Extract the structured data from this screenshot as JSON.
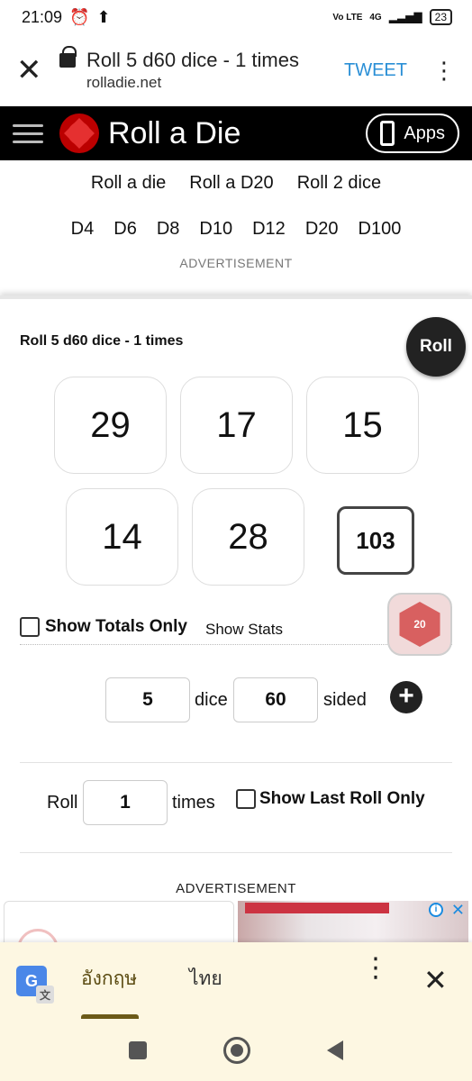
{
  "status": {
    "time": "21:09",
    "network": "4G",
    "volte": "Vo LTE",
    "battery": "23"
  },
  "browser": {
    "page_title": "Roll 5 d60 dice - 1 times",
    "host": "rolladie.net",
    "tweet_label": "TWEET"
  },
  "site": {
    "title": "Roll a Die",
    "apps_label": "Apps"
  },
  "nav_primary": [
    "Roll a die",
    "Roll a D20",
    "Roll 2 dice"
  ],
  "nav_dice": [
    "D4",
    "D6",
    "D8",
    "D10",
    "D12",
    "D20",
    "D100"
  ],
  "ad_label_top": "ADVERTISEMENT",
  "roller": {
    "title": "Roll 5 d60 dice - 1 times",
    "roll_label": "Roll",
    "results": [
      "29",
      "17",
      "15",
      "14",
      "28"
    ],
    "total": "103",
    "show_totals_label": "Show Totals Only",
    "show_stats_label": "Show Stats",
    "d20_badge": "20",
    "dice_count": "5",
    "dice_label": "dice",
    "sides": "60",
    "sided_label": "sided",
    "roll_times_label": "Roll",
    "times_value": "1",
    "times_label": "times",
    "show_last_label": "Show Last Roll Only"
  },
  "ad_label_bottom": "ADVERTISEMENT",
  "translate": {
    "lang_from": "อังกฤษ",
    "lang_to": "ไทย",
    "icon_letter": "G"
  }
}
